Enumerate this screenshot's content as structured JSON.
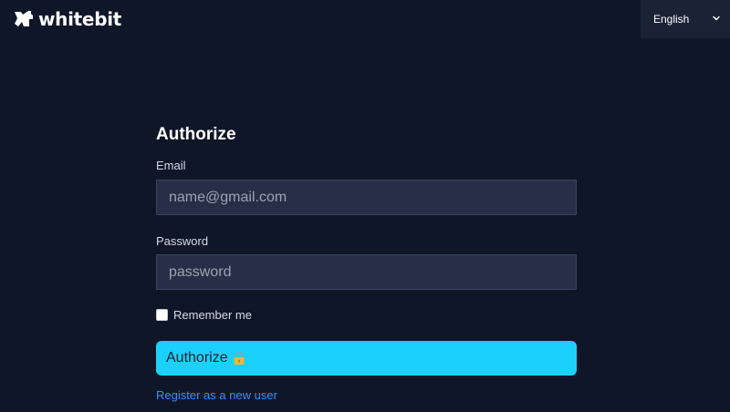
{
  "header": {
    "logo_text": "whitebit",
    "logo_icon": "whitebit-logo-icon",
    "language": {
      "selected": "English",
      "icon": "chevron-down-icon"
    }
  },
  "form": {
    "title": "Authorize",
    "email": {
      "label": "Email",
      "placeholder": "name@gmail.com",
      "value": ""
    },
    "password": {
      "label": "Password",
      "placeholder": "password",
      "value": ""
    },
    "remember": {
      "label": "Remember me",
      "checked": false
    },
    "submit": {
      "label": "Authorize",
      "icon": "lock-icon"
    },
    "register_link": "Register as a new user"
  },
  "colors": {
    "background": "#0f1628",
    "input_background": "#262f47",
    "accent": "#1ad1fb",
    "link": "#3d8ef2",
    "language_background": "#1a2236"
  }
}
